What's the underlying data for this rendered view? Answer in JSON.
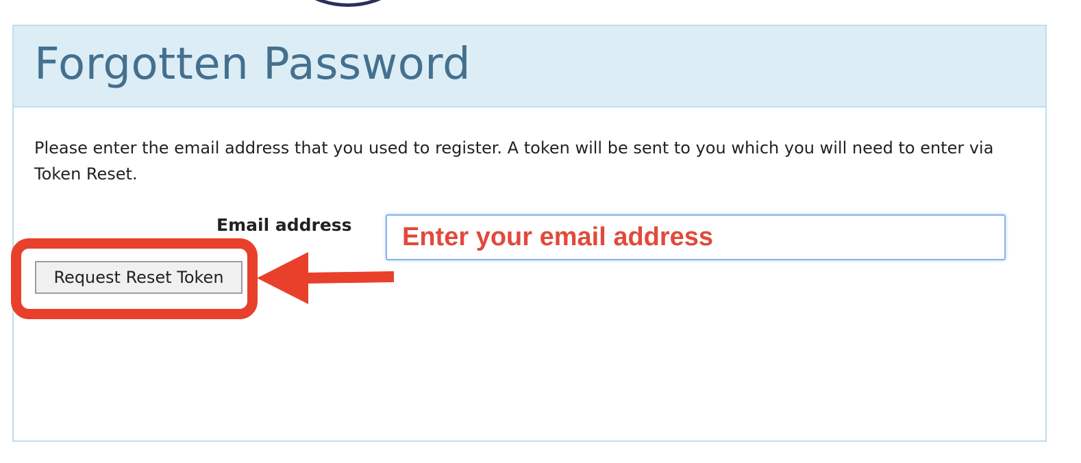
{
  "panel": {
    "title": "Forgotten Password"
  },
  "instructions": "Please enter the email address that you used to register. A token will be sent to you which you will need to enter via Token Reset.",
  "form": {
    "email_label": "Email address",
    "email_placeholder": "Enter your email address",
    "email_value": "",
    "submit_label": "Request Reset Token"
  },
  "annotation": {
    "color": "#e8402b",
    "highlight_target": "Request Reset Token"
  },
  "colors": {
    "heading_bg": "#dcedf6",
    "title": "#44708f",
    "border": "#bcdfea",
    "placeholder": "#e14a3b"
  }
}
